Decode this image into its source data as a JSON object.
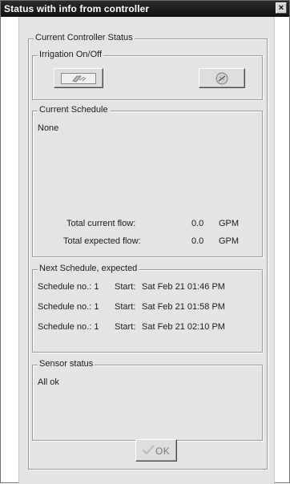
{
  "window": {
    "title": "Status with info from controller",
    "close_label": "×"
  },
  "groups": {
    "outer_label": "Current Controller Status",
    "irrigation_label": "Irrigation On/Off",
    "schedule_label": "Current Schedule",
    "next_label": "Next Schedule, expected",
    "sensor_label": "Sensor status"
  },
  "current_schedule": {
    "value": "None",
    "total_current_flow_label": "Total current flow:",
    "total_current_flow_value": "0.0",
    "total_current_flow_unit": "GPM",
    "total_expected_flow_label": "Total expected flow:",
    "total_expected_flow_value": "0.0",
    "total_expected_flow_unit": "GPM"
  },
  "next_schedule": {
    "rows": [
      {
        "schedule_label": "Schedule no.: 1",
        "start_label": "Start:",
        "start_value": "Sat Feb 21 01:46 PM"
      },
      {
        "schedule_label": "Schedule no.: 1",
        "start_label": "Start:",
        "start_value": "Sat Feb 21 01:58 PM"
      },
      {
        "schedule_label": "Schedule no.: 1",
        "start_label": "Start:",
        "start_value": "Sat Feb 21 02:10 PM"
      }
    ]
  },
  "sensor": {
    "status": "All ok"
  },
  "buttons": {
    "ok_label": "OK"
  },
  "icons": {
    "on_icon": "sprinkler-on-icon",
    "off_icon": "sprinkler-off-icon",
    "ok_icon": "check-icon"
  }
}
